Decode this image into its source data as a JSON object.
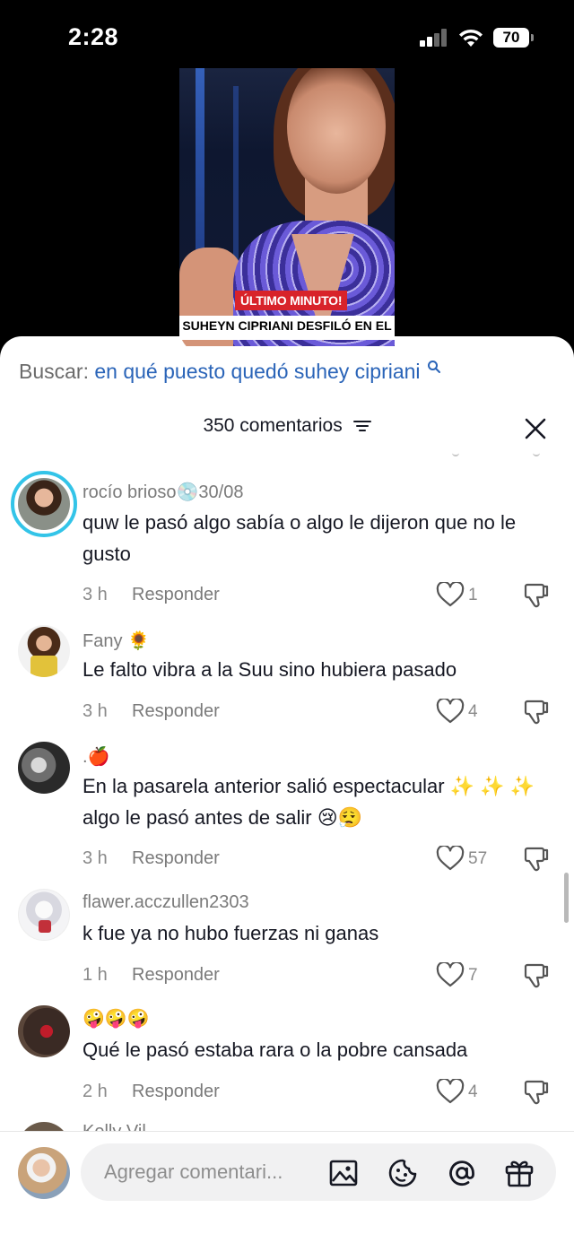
{
  "status_bar": {
    "time": "2:28",
    "battery": "70"
  },
  "video": {
    "badge": "ÚLTIMO MINUTO!",
    "headline": "SUHEYN CIPRIANI DESFILÓ EN EL"
  },
  "search": {
    "prefix": "Buscar:",
    "query": "en qué puesto quedó suhey cipriani"
  },
  "comments_header": {
    "count_label": "350 comentarios"
  },
  "comments": [
    {
      "username": "rocío brioso💿30/08",
      "text": "quw le pasó algo sabía o algo le dijeron que no le gusto",
      "time": "3 h",
      "reply": "Responder",
      "likes": "1"
    },
    {
      "username": "Fany 🌻",
      "text": "Le falto vibra a la Suu sino hubiera pasado",
      "time": "3 h",
      "reply": "Responder",
      "likes": "4"
    },
    {
      "username": ".🍎",
      "text": "En la pasarela anterior salió espectacular ✨ ✨ ✨ algo le pasó antes de salir 😢😮‍💨",
      "time": "3 h",
      "reply": "Responder",
      "likes": "57"
    },
    {
      "username": "flawer.acczullen2303",
      "text": "k fue ya no hubo fuerzas ni ganas",
      "time": "1 h",
      "reply": "Responder",
      "likes": "7"
    },
    {
      "username": "🤪🤪🤪",
      "text": "Qué le pasó estaba rara o la pobre cansada",
      "time": "2 h",
      "reply": "Responder",
      "likes": "4"
    }
  ],
  "partial_next": {
    "username": "Kelly Vil"
  },
  "input": {
    "placeholder": "Agregar comentari..."
  },
  "colors": {
    "link_blue": "#2a64b8",
    "story_ring": "#33c4e8",
    "text": "#161823",
    "muted": "#8a8a8a"
  }
}
